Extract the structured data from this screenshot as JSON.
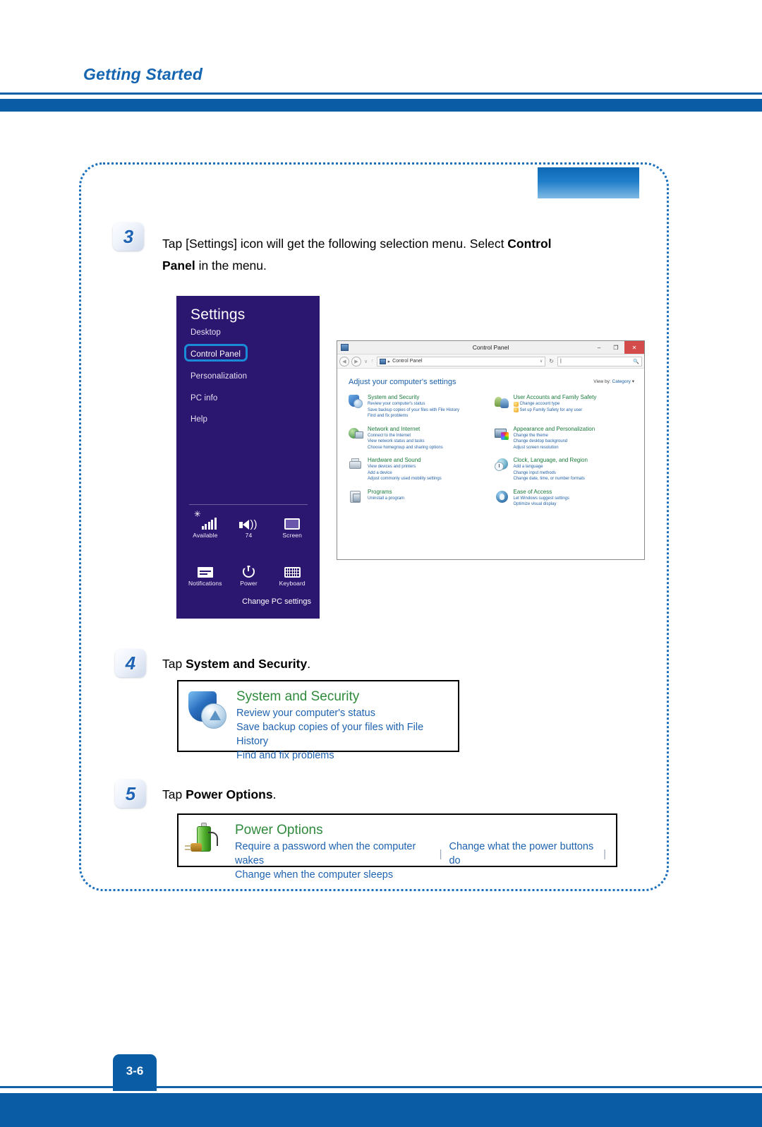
{
  "header": {
    "title": "Getting Started"
  },
  "footer": {
    "page_number": "3-6"
  },
  "steps": [
    {
      "number": "3",
      "text_prefix": "Tap [Settings] icon will get the following selection menu.   Select ",
      "text_bold": "Control Panel",
      "text_suffix": " in the menu."
    },
    {
      "number": "4",
      "text_prefix": "Tap ",
      "text_bold": "System and Security",
      "text_suffix": "."
    },
    {
      "number": "5",
      "text_prefix": "Tap ",
      "text_bold": "Power Options",
      "text_suffix": "."
    }
  ],
  "settings_charm": {
    "title": "Settings",
    "items": [
      {
        "label": "Desktop"
      },
      {
        "label": "Control Panel"
      },
      {
        "label": "Personalization"
      },
      {
        "label": "PC info"
      },
      {
        "label": "Help"
      }
    ],
    "highlighted_item": "Control Panel",
    "quick_icons": [
      {
        "icon": "wifi-icon",
        "label": "Available"
      },
      {
        "icon": "volume-icon",
        "label": "74"
      },
      {
        "icon": "screen-brightness-icon",
        "label": "Screen"
      },
      {
        "icon": "notifications-icon",
        "label": "Notifications"
      },
      {
        "icon": "power-icon",
        "label": "Power"
      },
      {
        "icon": "keyboard-icon",
        "label": "Keyboard"
      }
    ],
    "change_pc_settings": "Change PC settings"
  },
  "control_panel_window": {
    "title": "Control Panel",
    "window_buttons": {
      "minimize": "–",
      "maximize": "❐",
      "close": "✕"
    },
    "address": {
      "breadcrumb_root": "Control Panel",
      "breadcrumb_arrow": "▸",
      "dropdown_caret": "∨",
      "refresh": "↻",
      "search_value": "",
      "search_icon": "search-icon"
    },
    "heading": "Adjust your computer's settings",
    "view_by_label": "View by:",
    "view_by_value": "Category",
    "categories_left": [
      {
        "title": "System and Security",
        "links": [
          "Review your computer's status",
          "Save backup copies of your files with File History",
          "Find and fix problems"
        ]
      },
      {
        "title": "Network and Internet",
        "links": [
          "Connect to the Internet",
          "View network status and tasks",
          "Choose homegroup and sharing options"
        ]
      },
      {
        "title": "Hardware and Sound",
        "links": [
          "View devices and printers",
          "Add a device",
          "Adjust commonly used mobility settings"
        ]
      },
      {
        "title": "Programs",
        "links": [
          "Uninstall a program"
        ]
      }
    ],
    "categories_right": [
      {
        "title": "User Accounts and Family Safety",
        "links": [
          "Change account type",
          "Set up Family Safety for any user"
        ]
      },
      {
        "title": "Appearance and Personalization",
        "links": [
          "Change the theme",
          "Change desktop background",
          "Adjust screen resolution"
        ]
      },
      {
        "title": "Clock, Language, and Region",
        "links": [
          "Add a language",
          "Change input methods",
          "Change date, time, or number formats"
        ]
      },
      {
        "title": "Ease of Access",
        "links": [
          "Let Windows suggest settings",
          "Optimize visual display"
        ]
      }
    ]
  },
  "callouts": {
    "system_and_security": {
      "title": "System and Security",
      "links": [
        "Review your computer's status",
        "Save backup copies of your files with File History",
        "Find and fix problems"
      ]
    },
    "power_options": {
      "title": "Power Options",
      "link_row_1a": "Require a password when the computer wakes",
      "link_row_1b": "Change what the power buttons do",
      "link_row_2": "Change when the computer sleeps",
      "separator": "|"
    }
  },
  "colors": {
    "brand_blue": "#0a5ca4",
    "header_text": "#1565b0",
    "charm_purple": "#2b1670",
    "highlight_blue": "#1a8bd6",
    "link_blue": "#1f63b0",
    "category_green": "#2f8a3c"
  }
}
